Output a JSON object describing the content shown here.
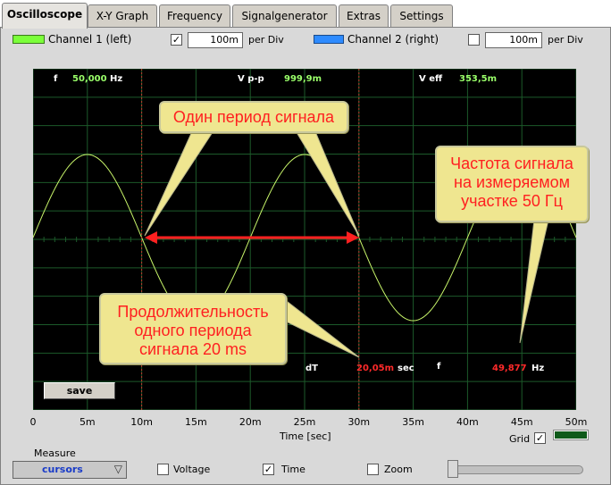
{
  "tabs": [
    {
      "label": "Oscilloscope",
      "active": true
    },
    {
      "label": "X-Y Graph",
      "active": false
    },
    {
      "label": "Frequency",
      "active": false
    },
    {
      "label": "Signalgenerator",
      "active": false
    },
    {
      "label": "Extras",
      "active": false
    },
    {
      "label": "Settings",
      "active": false
    }
  ],
  "channels": {
    "ch1": {
      "label": "Channel 1 (left)",
      "checked": true,
      "value": "100m",
      "per_div": "per Div",
      "color": "#7bff3a"
    },
    "ch2": {
      "label": "Channel 2 (right)",
      "checked": false,
      "value": "100m",
      "per_div": "per Div",
      "color": "#2e8bff"
    }
  },
  "readouts": {
    "f_label": "f",
    "f_value": "50,000",
    "f_unit": "Hz",
    "vpp_label": "V p-p",
    "vpp_value": "999,9m",
    "veff_label": "V eff",
    "veff_value": "353,5m",
    "dt_label": "dT",
    "dt_value": "20,05m",
    "dt_unit": "sec",
    "f2_label": "f",
    "f2_value": "49,877",
    "f2_unit": "Hz"
  },
  "annotations": {
    "period": "Один период сигнала",
    "frequency": [
      "Частота сигнала",
      "на измеряемом",
      "участке 50 Гц"
    ],
    "duration": [
      "Продолжительность",
      "одного периода",
      "сигнала 20 ms"
    ]
  },
  "chart_data": {
    "type": "line",
    "xlabel": "Time [sec]",
    "x_ticks": [
      "0",
      "5m",
      "10m",
      "15m",
      "20m",
      "25m",
      "30m",
      "35m",
      "40m",
      "45m",
      "50m"
    ],
    "xlim": [
      0,
      0.05
    ],
    "series": [
      {
        "frequency_hz": 50,
        "amplitude_vpp": 0.9999,
        "color": "#c8f56a"
      }
    ],
    "cursors": [
      0.01,
      0.03
    ],
    "cursor_color": "#c0392b",
    "grid": true
  },
  "save_label": "save",
  "grid_label": "Grid",
  "grid_checked": true,
  "measure": {
    "title": "Measure",
    "mode": "cursors",
    "options": [
      {
        "label": "Voltage",
        "checked": false
      },
      {
        "label": "Time",
        "checked": true
      },
      {
        "label": "Zoom",
        "checked": false
      }
    ]
  }
}
